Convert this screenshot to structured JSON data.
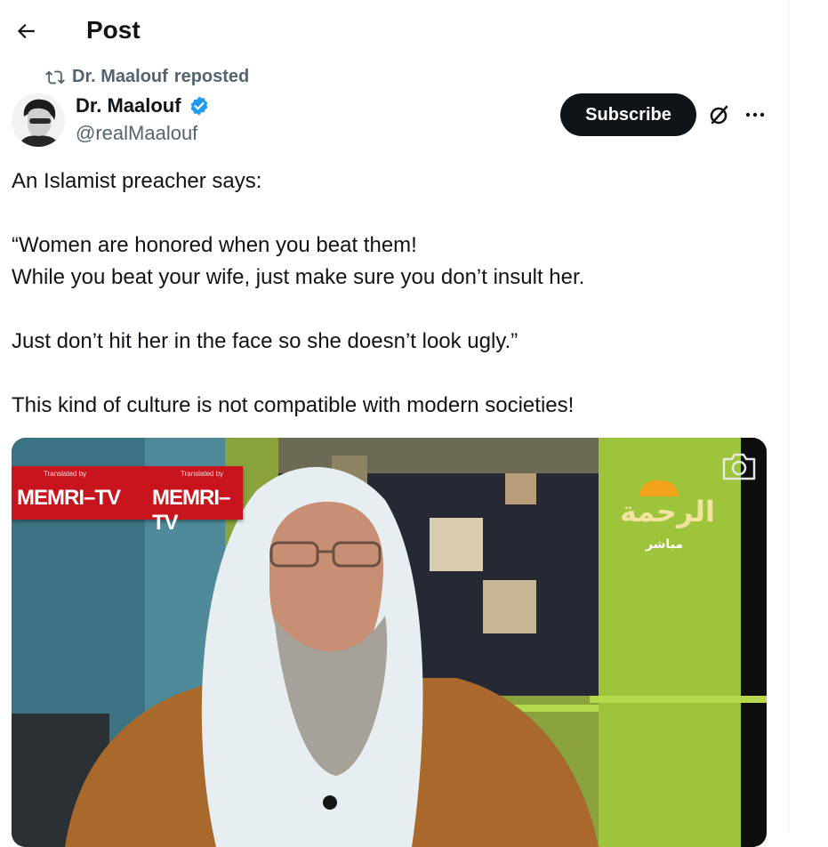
{
  "header": {
    "title": "Post"
  },
  "repost": {
    "user": "Dr. Maalouf",
    "label": "reposted"
  },
  "author": {
    "name": "Dr. Maalouf",
    "handle": "@realMaalouf"
  },
  "actions": {
    "subscribe_label": "Subscribe"
  },
  "post": {
    "lines": [
      "An Islamist preacher says:",
      "",
      "“Women are honored when you beat them!",
      "While you beat your wife, just make sure you don’t insult her.",
      "",
      "Just don’t hit her in the face so she doesn’t look ugly.”",
      "",
      "This kind of culture is not compatible with modern societies!"
    ]
  },
  "media": {
    "banner_text": [
      "MEMRI–TV",
      "MEMRI–TV"
    ],
    "banner_subtext": [
      "Translated by",
      "Translated by"
    ],
    "channel_logo": "الرحمة",
    "channel_sub": "مباشر"
  },
  "colors": {
    "accent": "#1d9bf0",
    "muted": "#536471",
    "text": "#0f1419"
  }
}
